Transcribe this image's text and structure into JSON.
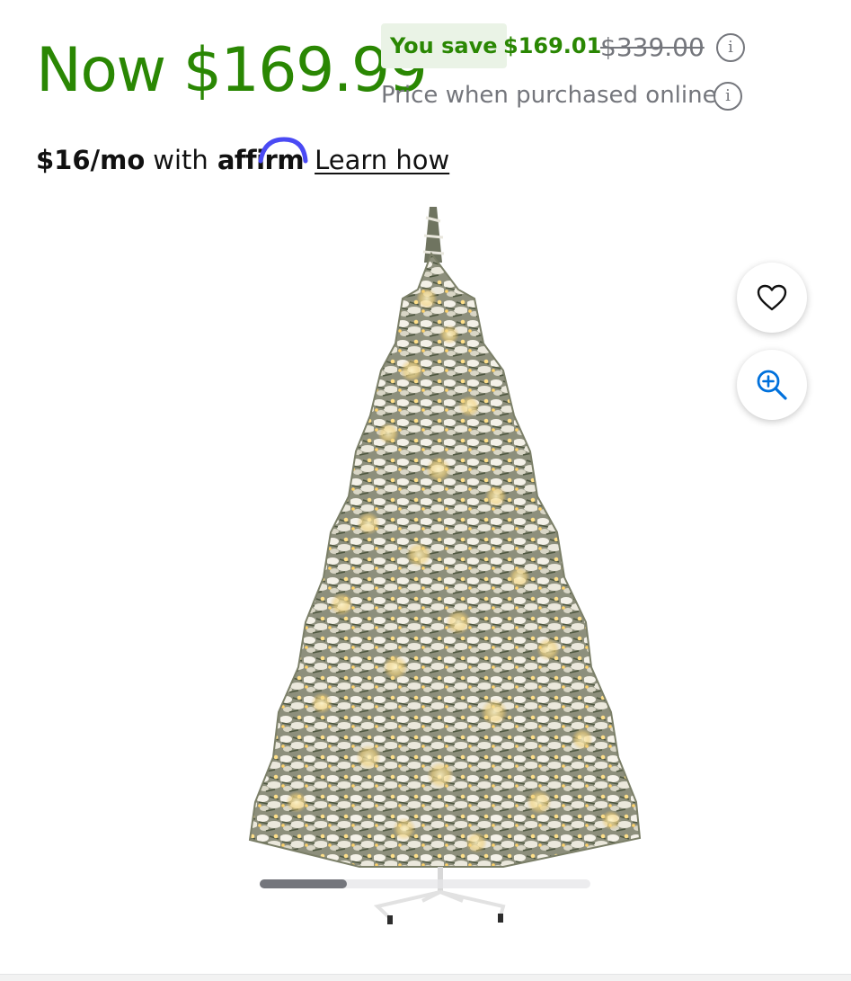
{
  "price": {
    "now": "Now $169.99",
    "you_save_label": "You save",
    "save_amount": "$169.01",
    "was_price": "$339.00",
    "online_note": "Price when purchased online",
    "info_glyph": "i"
  },
  "financing": {
    "monthly": "$16/mo",
    "with": "with",
    "provider": "affirm",
    "learn_how": "Learn how"
  },
  "image_actions": {
    "favorite_icon": "heart-outline-icon",
    "zoom_icon": "zoom-in-icon"
  },
  "image_carousel": {
    "image_index": 1,
    "position_fraction": 0.26
  },
  "colors": {
    "price_green": "#2a8703",
    "save_badge_bg": "#eaf3e6",
    "muted_gray": "#74767c",
    "zoom_blue": "#0071dc",
    "affirm_arc": "#4a4af4"
  }
}
